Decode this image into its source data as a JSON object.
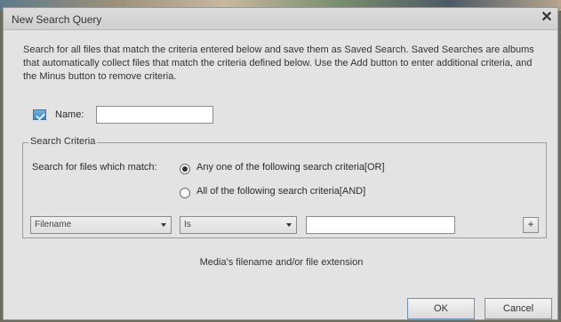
{
  "dialog": {
    "title": "New Search Query",
    "close_glyph": "✕",
    "description": "Search for all files that match the criteria entered below and save them as Saved Search. Saved Searches are albums that automatically collect files that match the criteria defined below. Use the Add button to enter additional criteria, and the Minus button to remove criteria."
  },
  "name_field": {
    "label": "Name:",
    "value": "",
    "icon": "smart-album-icon"
  },
  "criteria": {
    "legend": "Search Criteria",
    "match_label": "Search for files which match:",
    "options": [
      {
        "label": "Any one of the following search criteria[OR]",
        "selected": true
      },
      {
        "label": "All of the following search criteria[AND]",
        "selected": false
      }
    ],
    "rule": {
      "field_value": "Filename",
      "operator_value": "Is",
      "text_value": "",
      "add_label": "+"
    }
  },
  "media_description": "Media's filename and/or file extension",
  "buttons": {
    "ok": "OK",
    "cancel": "Cancel"
  }
}
